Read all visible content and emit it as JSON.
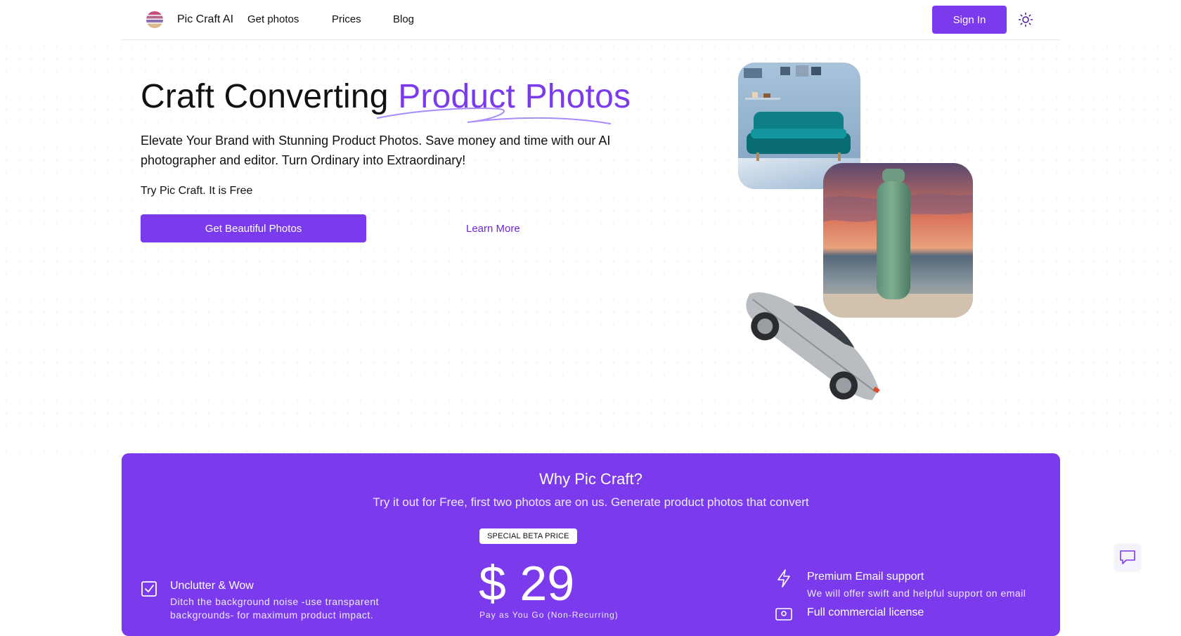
{
  "nav": {
    "brand": "Pic Craft AI",
    "links": [
      "Get photos",
      "Prices",
      "Blog"
    ],
    "signin": "Sign In"
  },
  "hero": {
    "title_plain": "Craft Converting ",
    "title_accent": "Product Photos",
    "subtitle": "Elevate Your Brand with Stunning Product Photos. Save money and time with our AI photographer and editor. Turn Ordinary into Extraordinary!",
    "try_text": "Try Pic Craft. It is Free",
    "cta": "Get Beautiful Photos",
    "learn_more": "Learn More"
  },
  "why": {
    "title": "Why Pic Craft?",
    "subtitle": "Try it out for Free, first two photos are on us. Generate product photos that convert",
    "badge": "SPECIAL BETA PRICE",
    "price": "$ 29",
    "price_note": "Pay as You Go (Non-Recurring)",
    "features_left": [
      {
        "title": "Unclutter & Wow",
        "desc_line1": "Ditch the background noise -use transparent",
        "desc_line2": "backgrounds- for maximum product impact."
      }
    ],
    "features_right": [
      {
        "title": "Premium Email support",
        "desc": "We will offer swift and helpful support on email"
      },
      {
        "title": "Full commercial license",
        "desc": ""
      }
    ]
  },
  "colors": {
    "accent": "#7c3aed",
    "accent_text": "#6d28d9",
    "white": "#ffffff"
  },
  "icons": {
    "logo": "stacked-spheres-logo",
    "theme": "sun-icon",
    "check": "checkbox-check-icon",
    "bolt": "lightning-icon",
    "license": "id-card-icon",
    "chat": "chat-icon"
  }
}
